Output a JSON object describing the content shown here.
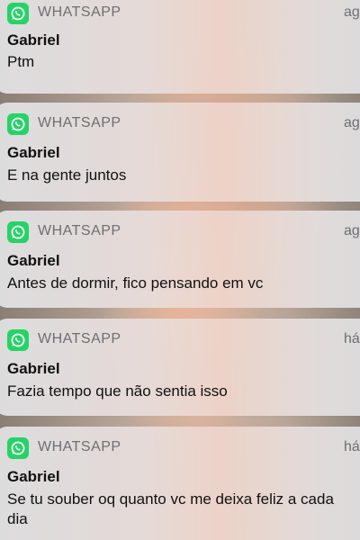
{
  "notifications": [
    {
      "app": "WHATSAPP",
      "time": "ag",
      "title": "Gabriel",
      "message": "Ptm"
    },
    {
      "app": "WHATSAPP",
      "time": "ag",
      "title": "Gabriel",
      "message": "E na gente juntos"
    },
    {
      "app": "WHATSAPP",
      "time": "ag",
      "title": "Gabriel",
      "message": "Antes de dormir, fico pensando em vc"
    },
    {
      "app": "WHATSAPP",
      "time": "há",
      "title": "Gabriel",
      "message": "Fazia tempo que não sentia isso"
    },
    {
      "app": "WHATSAPP",
      "time": "há",
      "title": "Gabriel",
      "message": "Se tu souber oq quanto vc me deixa feliz a cada dia"
    }
  ],
  "app_icon": "whatsapp-icon",
  "colors": {
    "whatsapp_green": "#25d366"
  }
}
